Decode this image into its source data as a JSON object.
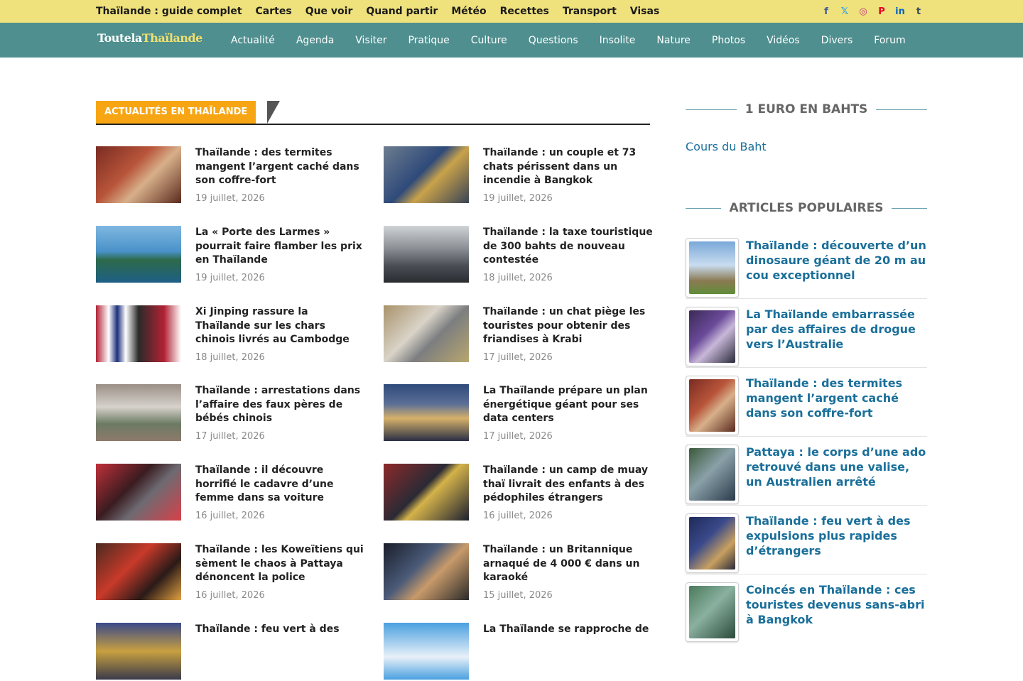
{
  "topbar": {
    "links": [
      "Thaïlande : guide complet",
      "Cartes",
      "Que voir",
      "Quand partir",
      "Météo",
      "Recettes",
      "Transport",
      "Visas"
    ],
    "social": [
      {
        "name": "facebook-icon",
        "glyph": "f",
        "color": "#3b5998"
      },
      {
        "name": "x-icon",
        "glyph": "𝕏",
        "color": "#1da1f2"
      },
      {
        "name": "instagram-icon",
        "glyph": "◎",
        "color": "#c13584"
      },
      {
        "name": "pinterest-icon",
        "glyph": "P",
        "color": "#e60023"
      },
      {
        "name": "linkedin-icon",
        "glyph": "in",
        "color": "#0a66c2"
      },
      {
        "name": "tumblr-icon",
        "glyph": "t",
        "color": "#35465c"
      }
    ]
  },
  "logo": {
    "part1": "Toutela",
    "part2": "Thaïlande"
  },
  "nav": [
    "Actualité",
    "Agenda",
    "Visiter",
    "Pratique",
    "Culture",
    "Questions",
    "Insolite",
    "Nature",
    "Photos",
    "Vidéos",
    "Divers",
    "Forum"
  ],
  "section": {
    "label": "ACTUALITÉS EN THAÏLANDE"
  },
  "articles": [
    {
      "title": "Thaïlande : des termites mangent l’argent caché dans son coffre-fort",
      "date": "19 juillet, 2026"
    },
    {
      "title": "Thaïlande : un couple et 73 chats périssent dans un incendie à Bangkok",
      "date": "19 juillet, 2026"
    },
    {
      "title": "La « Porte des Larmes » pourrait faire flamber les prix en Thaïlande",
      "date": "19 juillet, 2026"
    },
    {
      "title": "Thaïlande : la taxe touristique de 300 bahts de nouveau contestée",
      "date": "18 juillet, 2026"
    },
    {
      "title": "Xi Jinping rassure la Thaïlande sur les chars chinois livrés au Cambodge",
      "date": "18 juillet, 2026"
    },
    {
      "title": "Thaïlande : un chat piège les touristes pour obtenir des friandises à Krabi",
      "date": "17 juillet, 2026"
    },
    {
      "title": "Thaïlande : arrestations dans l’affaire des faux pères de bébés chinois",
      "date": "17 juillet, 2026"
    },
    {
      "title": "La Thaïlande prépare un plan énergétique géant pour ses data centers",
      "date": "17 juillet, 2026"
    },
    {
      "title": "Thaïlande : il découvre horrifié le cadavre d’une femme dans sa voiture",
      "date": "16 juillet, 2026"
    },
    {
      "title": "Thaïlande : un camp de muay thaï livrait des enfants à des pédophiles étrangers",
      "date": "16 juillet, 2026"
    },
    {
      "title": "Thaïlande : les Koweïtiens qui sèment le chaos à Pattaya dénoncent la police",
      "date": "16 juillet, 2026"
    },
    {
      "title": "Thaïlande : un Britannique arnaqué de 4 000 € dans un karaoké",
      "date": "15 juillet, 2026"
    },
    {
      "title": "Thaïlande : feu vert à des",
      "date": ""
    },
    {
      "title": "La Thaïlande se rapproche de",
      "date": ""
    }
  ],
  "sidebar": {
    "euro_heading": "1 EURO EN BAHTS",
    "euro_link": "Cours du Baht",
    "popular_heading": "ARTICLES POPULAIRES",
    "popular": [
      {
        "title": "Thaïlande : découverte d’un dinosaure géant de 20 m au cou exceptionnel"
      },
      {
        "title": "La Thaïlande embarrassée par des affaires de drogue vers l’Australie"
      },
      {
        "title": "Thaïlande : des termites mangent l’argent caché dans son coffre-fort"
      },
      {
        "title": "Pattaya : le corps d’une ado retrouvé dans une valise, un Australien arrêté"
      },
      {
        "title": "Thaïlande : feu vert à des expulsions plus rapides d’étrangers"
      },
      {
        "title": "Coincés en Thaïlande : ces touristes devenus sans-abri à Bangkok"
      }
    ]
  },
  "colors": {
    "topbar": "#efe17b",
    "navbar": "#4f8f8f",
    "accent": "#f7a513",
    "link": "#1a6f9a"
  }
}
